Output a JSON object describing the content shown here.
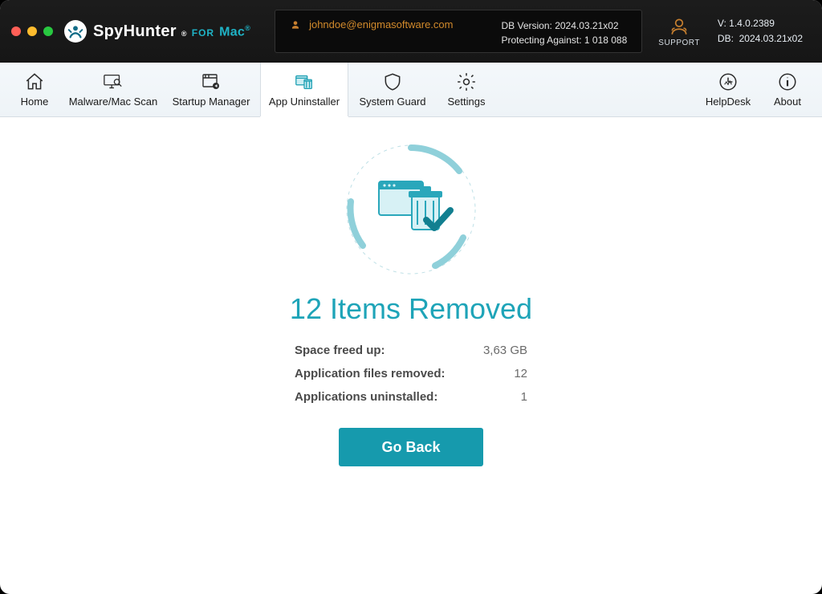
{
  "window": {
    "product_name": "SpyHunter",
    "product_for": "FOR",
    "product_mac": "Mac"
  },
  "header": {
    "email": "johndoe@enigmasoftware.com",
    "db_version_label": "DB Version:",
    "db_version_value": "2024.03.21x02",
    "protecting_label": "Protecting Against:",
    "protecting_value": "1 018 088",
    "support_label": "SUPPORT",
    "version_label": "V:",
    "version_value": "1.4.0.2389",
    "db_label": "DB:",
    "db_value": "2024.03.21x02"
  },
  "toolbar": {
    "home": "Home",
    "scan": "Malware/Mac Scan",
    "startup": "Startup Manager",
    "uninstaller": "App Uninstaller",
    "guard": "System Guard",
    "settings": "Settings",
    "helpdesk": "HelpDesk",
    "about": "About"
  },
  "result": {
    "headline": "12 Items Removed",
    "rows": {
      "space_label": "Space freed up:",
      "space_value": "3,63 GB",
      "files_label": "Application files removed:",
      "files_value": "12",
      "apps_label": "Applications uninstalled:",
      "apps_value": "1"
    },
    "go_back": "Go Back"
  }
}
